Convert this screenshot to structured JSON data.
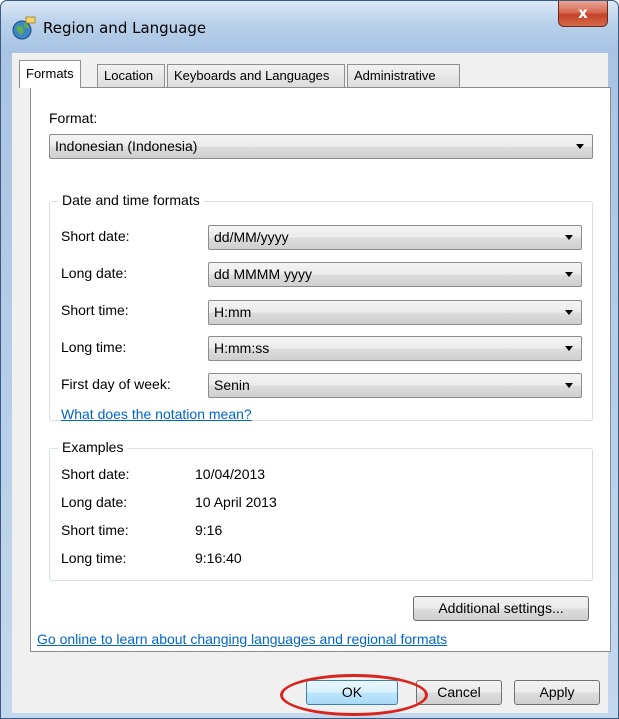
{
  "window": {
    "title": "Region and Language",
    "close_label": "x"
  },
  "tabs": [
    {
      "label": "Formats",
      "active": true
    },
    {
      "label": "Location",
      "active": false
    },
    {
      "label": "Keyboards and Languages",
      "active": false
    },
    {
      "label": "Administrative",
      "active": false
    }
  ],
  "format": {
    "label": "Format:",
    "value": "Indonesian (Indonesia)"
  },
  "date_time": {
    "title": "Date and time formats",
    "rows": [
      {
        "label": "Short date:",
        "value": "dd/MM/yyyy"
      },
      {
        "label": "Long date:",
        "value": "dd MMMM yyyy"
      },
      {
        "label": "Short time:",
        "value": "H:mm"
      },
      {
        "label": "Long time:",
        "value": "H:mm:ss"
      },
      {
        "label": "First day of week:",
        "value": "Senin"
      }
    ],
    "notation_link": "What does the notation mean?"
  },
  "examples": {
    "title": "Examples",
    "rows": [
      {
        "label": "Short date:",
        "value": "10/04/2013"
      },
      {
        "label": "Long date:",
        "value": "10 April 2013"
      },
      {
        "label": "Short time:",
        "value": "9:16"
      },
      {
        "label": "Long time:",
        "value": "9:16:40"
      }
    ]
  },
  "additional_settings": "Additional settings...",
  "online_link": "Go online to learn about changing languages and regional formats",
  "buttons": {
    "ok": "OK",
    "cancel": "Cancel",
    "apply": "Apply"
  },
  "colors": {
    "link": "#0066cc",
    "highlight_ring": "#d9241c",
    "close_button": "#c4432a"
  }
}
